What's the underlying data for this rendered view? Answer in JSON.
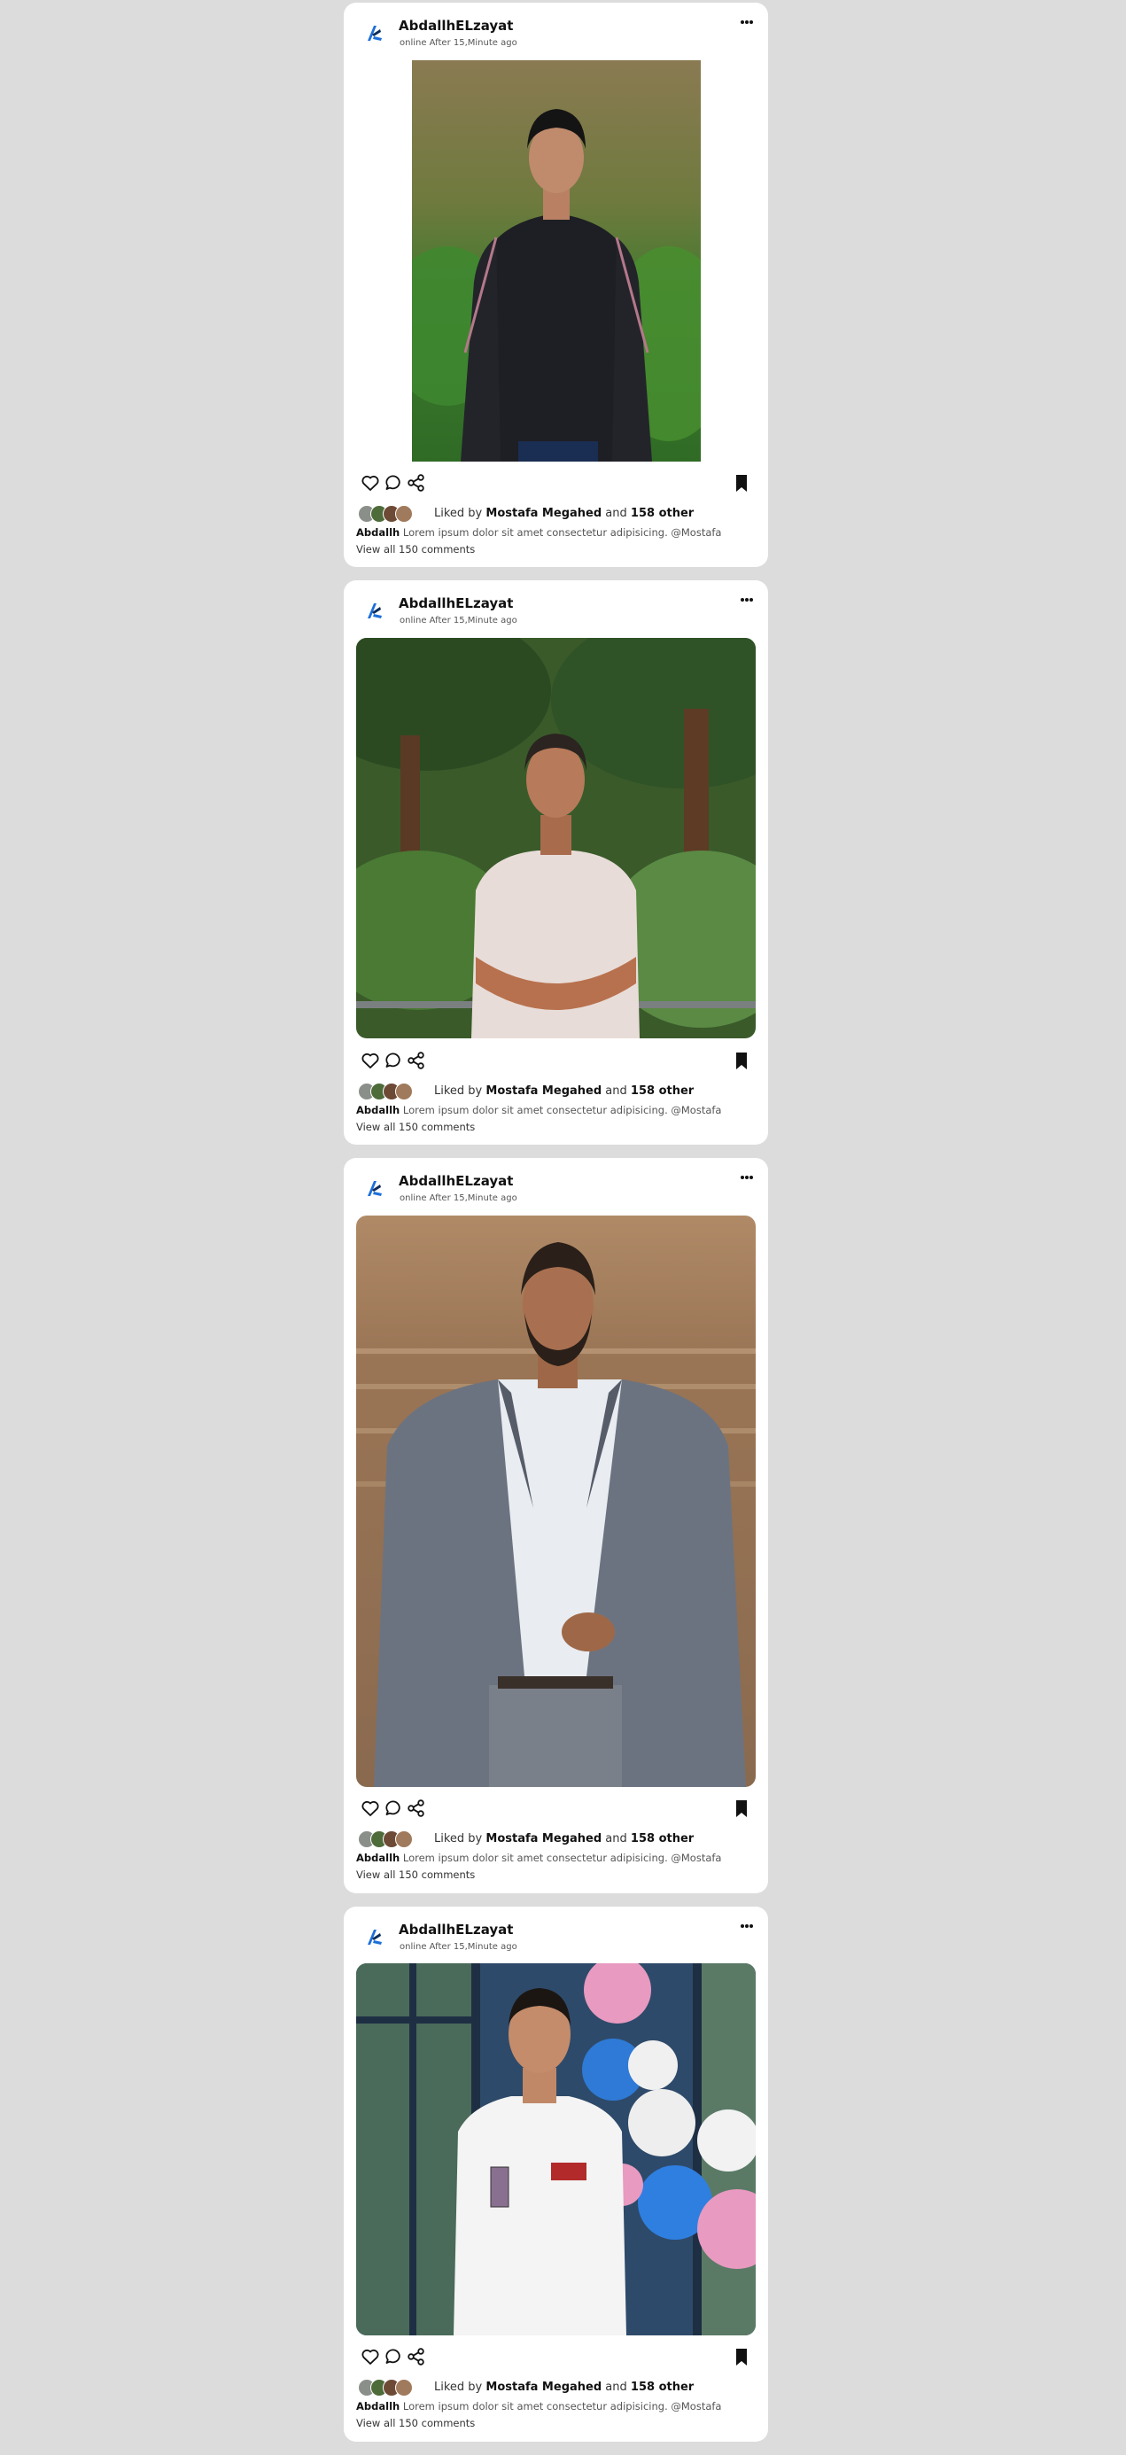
{
  "colors": {
    "page_background": "#dcdcdc",
    "card_background": "#ffffff",
    "brand_blue": "#1e6fd9"
  },
  "icons": {
    "more": "more-horizontal-icon",
    "like": "heart-icon",
    "comment": "comment-icon",
    "share": "share-icon",
    "bookmark": "bookmark-icon",
    "avatar": "brand-logo-icon"
  },
  "posts": [
    {
      "author": "AbdallhELzayat",
      "status": "online After 15,Minute ago",
      "liked_prefix": "Liked by",
      "liked_user": "Mostafa Megahed",
      "liked_and": "and",
      "liked_count": "158 other",
      "caption_user": "Abdallh",
      "caption_text": "Lorem ipsum dolor sit amet consectetur adipisicing. @Mostafa",
      "view_comments": "View all 150 comments"
    },
    {
      "author": "AbdallhELzayat",
      "status": "online After 15,Minute ago",
      "liked_prefix": "Liked by",
      "liked_user": "Mostafa Megahed",
      "liked_and": "and",
      "liked_count": "158 other",
      "caption_user": "Abdallh",
      "caption_text": "Lorem ipsum dolor sit amet consectetur adipisicing. @Mostafa",
      "view_comments": "View all 150 comments"
    },
    {
      "author": "AbdallhELzayat",
      "status": "online After 15,Minute ago",
      "liked_prefix": "Liked by",
      "liked_user": "Mostafa Megahed",
      "liked_and": "and",
      "liked_count": "158 other",
      "caption_user": "Abdallh",
      "caption_text": "Lorem ipsum dolor sit amet consectetur adipisicing. @Mostafa",
      "view_comments": "View all 150 comments"
    },
    {
      "author": "AbdallhELzayat",
      "status": "online After 15,Minute ago",
      "liked_prefix": "Liked by",
      "liked_user": "Mostafa Megahed",
      "liked_and": "and",
      "liked_count": "158 other",
      "caption_user": "Abdallh",
      "caption_text": "Lorem ipsum dolor sit amet consectetur adipisicing. @Mostafa",
      "view_comments": "View all 150 comments"
    }
  ]
}
